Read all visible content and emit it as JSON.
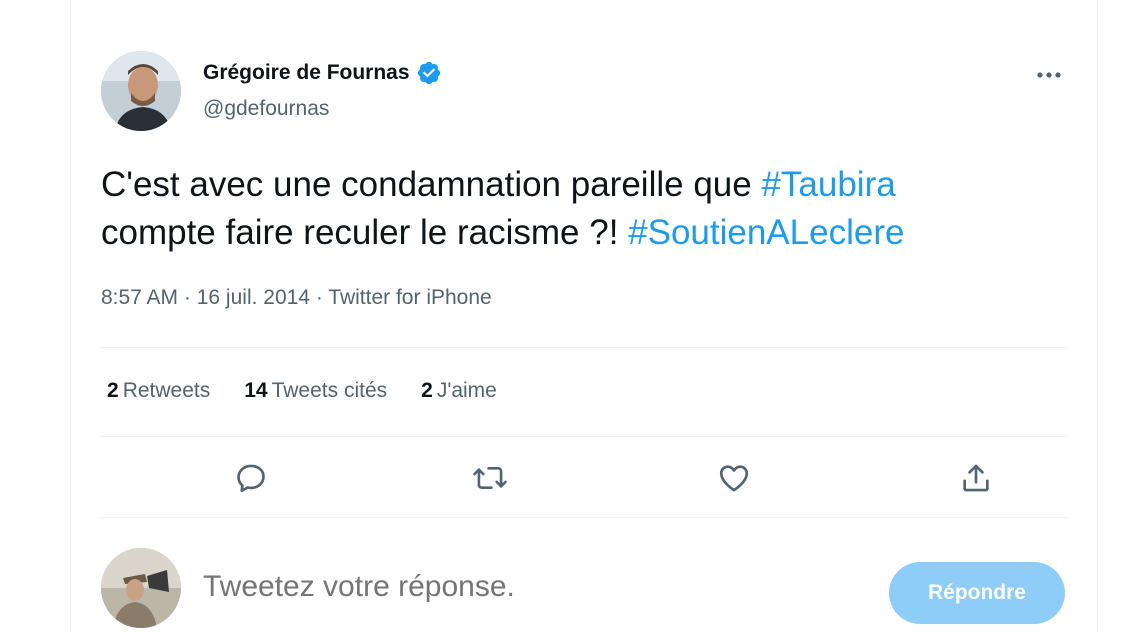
{
  "author": {
    "name": "Grégoire de Fournas",
    "handle": "@gdefournas",
    "verified_icon": "verified-badge-icon"
  },
  "tweet": {
    "text_part1": "C'est avec une condamnation pareille que ",
    "hashtag1": "#Taubira",
    "text_part2": "compte faire reculer le racisme ?! ",
    "hashtag2": "#SoutienALeclere",
    "time": "8:57 AM",
    "separator": " · ",
    "date": "16 juil. 2014",
    "source": "Twitter for iPhone"
  },
  "stats": [
    {
      "count": "2",
      "label": "Retweets"
    },
    {
      "count": "14",
      "label": "Tweets cités"
    },
    {
      "count": "2",
      "label": "J'aime"
    }
  ],
  "actions": [
    "reply-icon",
    "retweet-icon",
    "like-icon",
    "share-icon"
  ],
  "reply": {
    "placeholder": "Tweetez votre réponse.",
    "button_label": "Répondre"
  },
  "colors": {
    "accent": "#1d9bf0",
    "reply_button_disabled": "#8ecdf8",
    "secondary_text": "#536471"
  }
}
